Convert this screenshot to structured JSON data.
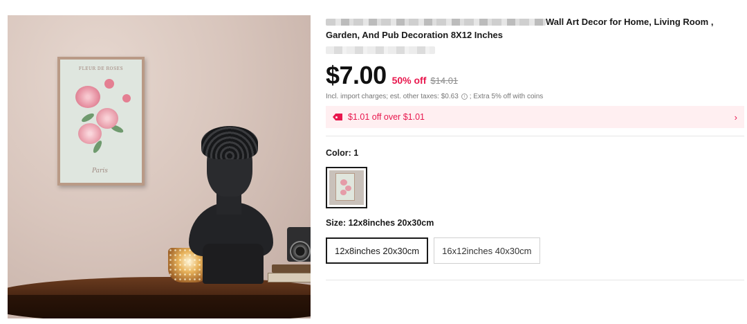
{
  "product": {
    "title_suffix": "Wall Art Decor for Home, Living Room ,",
    "title_line2": "Garden, And Pub Decoration 8X12 Inches",
    "image_sign_title": "FLEUR DE ROSES",
    "image_sign_script": "Paris"
  },
  "pricing": {
    "price": "$7.00",
    "discount": "50% off",
    "original_price": "$14.01",
    "taxes_text": "Incl. import charges; est. other taxes: $0.63",
    "coins_text": "; Extra 5% off with coins"
  },
  "coupon": {
    "text": "$1.01 off over $1.01",
    "chevron": "›"
  },
  "color": {
    "label": "Color: 1",
    "selected_index": 0
  },
  "size": {
    "label": "Size: 12x8inches 20x30cm",
    "options": [
      "12x8inches 20x30cm",
      "16x12inches 40x30cm"
    ],
    "selected_index": 0
  },
  "icons": {
    "info": "info-icon",
    "tag": "tag-icon",
    "chevron": "chevron-right-icon"
  },
  "colors": {
    "accent": "#e8174d",
    "coupon_bg": "#ffeff1"
  }
}
